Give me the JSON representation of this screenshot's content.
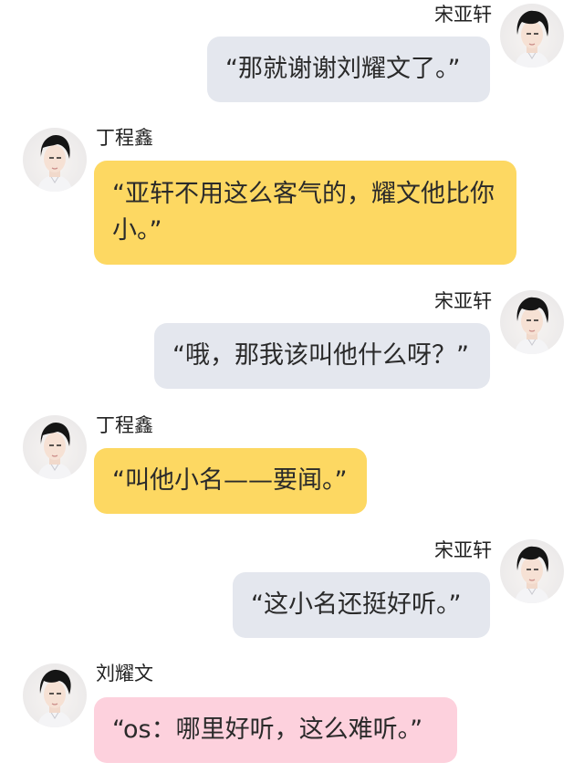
{
  "colors": {
    "bubble_gray": "#e4e7ee",
    "bubble_yellow": "#fdd862",
    "bubble_pink": "#fdd1dd",
    "background": "#ffffff"
  },
  "messages": [
    {
      "sender": "宋亚轩",
      "side": "right",
      "bubble_color": "gray",
      "avatar_icon": "person-avatar-icon",
      "text": "“那就谢谢刘耀文了。”"
    },
    {
      "sender": "丁程鑫",
      "side": "left",
      "bubble_color": "yellow",
      "avatar_icon": "person-avatar-icon",
      "text": "“亚轩不用这么客气的，耀文他比你小。”"
    },
    {
      "sender": "宋亚轩",
      "side": "right",
      "bubble_color": "gray",
      "avatar_icon": "person-avatar-icon",
      "text": "“哦，那我该叫他什么呀？”"
    },
    {
      "sender": "丁程鑫",
      "side": "left",
      "bubble_color": "yellow",
      "avatar_icon": "person-avatar-icon",
      "text": "“叫他小名——要闻。”"
    },
    {
      "sender": "宋亚轩",
      "side": "right",
      "bubble_color": "gray",
      "avatar_icon": "person-avatar-icon",
      "text": "“这小名还挺好听。”"
    },
    {
      "sender": "刘耀文",
      "side": "left",
      "bubble_color": "pink",
      "avatar_icon": "person-avatar-icon",
      "text": "“os：哪里好听，这么难听。”"
    }
  ]
}
